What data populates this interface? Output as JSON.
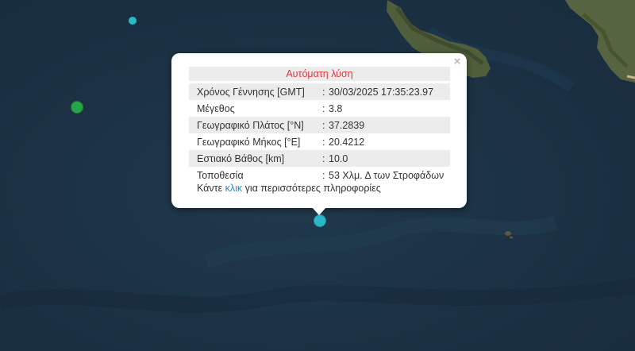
{
  "colors": {
    "sea": "#1d3447",
    "land": "#4d5b3a",
    "marker_cyan": "#2bb9c9",
    "marker_green": "#26a64b",
    "title_red": "#d9393d",
    "link_blue": "#2a8ab0"
  },
  "popup": {
    "title": "Αυτόματη λύση",
    "close_label": "×",
    "rows": [
      {
        "label": "Χρόνος Γέννησης [GMT]",
        "sep": ":",
        "value": "30/03/2025 17:35:23.97"
      },
      {
        "label": "Μέγεθος",
        "sep": ":",
        "value": "3.8"
      },
      {
        "label": "Γεωγραφικό Πλάτος [°N]",
        "sep": ":",
        "value": "37.2839"
      },
      {
        "label": "Γεωγραφικό Μήκος [°E]",
        "sep": ":",
        "value": "20.4212"
      },
      {
        "label": "Εστιακό Βάθος [km]",
        "sep": ":",
        "value": "10.0"
      },
      {
        "label": "Τοποθεσία",
        "sep": ":",
        "value": "53 Χλμ. Δ των Στροφάδων"
      }
    ],
    "more_prefix": "Κάντε ",
    "more_link": "κλικ",
    "more_suffix": " για περισσότερες πληροφορίες"
  }
}
